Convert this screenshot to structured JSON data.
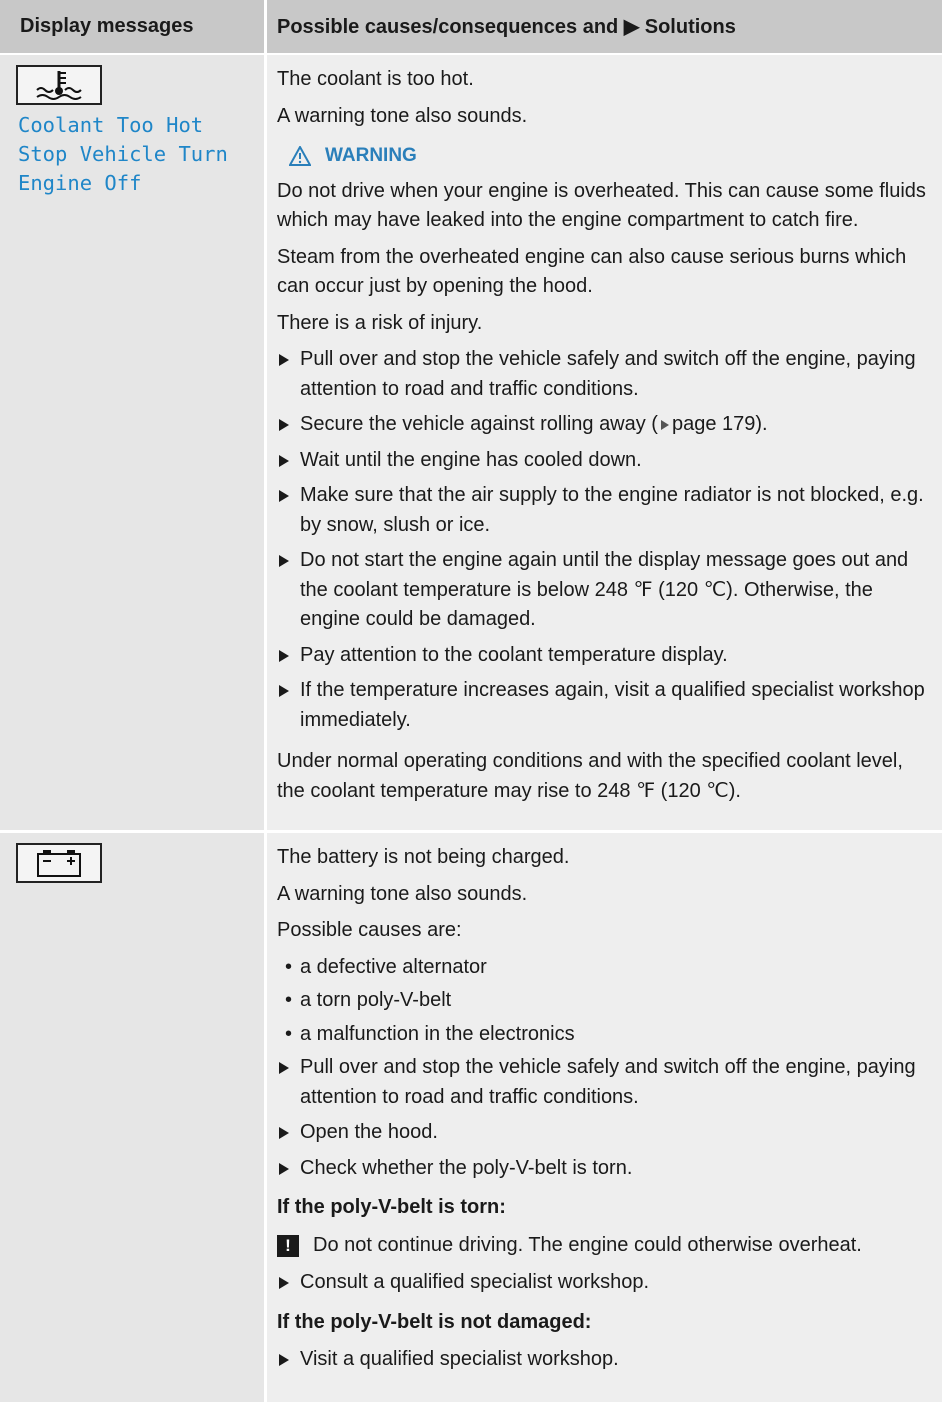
{
  "header": {
    "col1": "Display messages",
    "col2": "Possible causes/consequences and ▶ Solutions"
  },
  "coolant": {
    "icon": "coolant-temperature-icon",
    "message_lines": [
      "Coolant Too Hot",
      "Stop Vehicle Turn",
      "Engine Off"
    ],
    "intro": [
      "The coolant is too hot.",
      "A warning tone also sounds."
    ],
    "warning_label": "WARNING",
    "warning_paragraphs": [
      "Do not drive when your engine is overheated. This can cause some fluids which may have leaked into the engine compartment to catch fire.",
      "Steam from the overheated engine can also cause serious burns which can occur just by opening the hood.",
      "There is a risk of injury."
    ],
    "steps": [
      "Pull over and stop the vehicle safely and switch off the engine, paying attention to road and traffic conditions.",
      "Secure the vehicle against rolling away (",
      "Wait until the engine has cooled down.",
      "Make sure that the air supply to the engine radiator is not blocked, e.g. by snow, slush or ice.",
      "Do not start the engine again until the display message goes out and the coolant temperature is below 248 ℉ (120 ℃). Otherwise, the engine could be damaged.",
      "Pay attention to the coolant temperature display.",
      "If the temperature increases again, visit a qualified specialist workshop immediately."
    ],
    "page_ref_suffix": "page 179).",
    "closing": "Under normal operating conditions and with the specified coolant level, the coolant temperature may rise to 248 ℉ (120 ℃)."
  },
  "battery": {
    "icon": "battery-icon",
    "intro": [
      "The battery is not being charged.",
      "A warning tone also sounds.",
      "Possible causes are:"
    ],
    "causes": [
      "a defective alternator",
      "a torn poly-V-belt",
      "a malfunction in the electronics"
    ],
    "steps": [
      "Pull over and stop the vehicle safely and switch off the engine, paying attention to road and traffic conditions.",
      "Open the hood.",
      "Check whether the poly-V-belt is torn."
    ],
    "torn_heading": "If the poly-V-belt is torn:",
    "notice": "Do not continue driving. The engine could otherwise overheat.",
    "torn_step": "Consult a qualified specialist workshop.",
    "ok_heading": "If the poly-V-belt is not damaged:",
    "ok_step": "Visit a qualified specialist workshop."
  },
  "colors": {
    "display_text": "#1f86c8",
    "warning_text": "#2a7fba",
    "header_bg": "#c8c8c8",
    "cell_bg": "#eeeeee"
  }
}
